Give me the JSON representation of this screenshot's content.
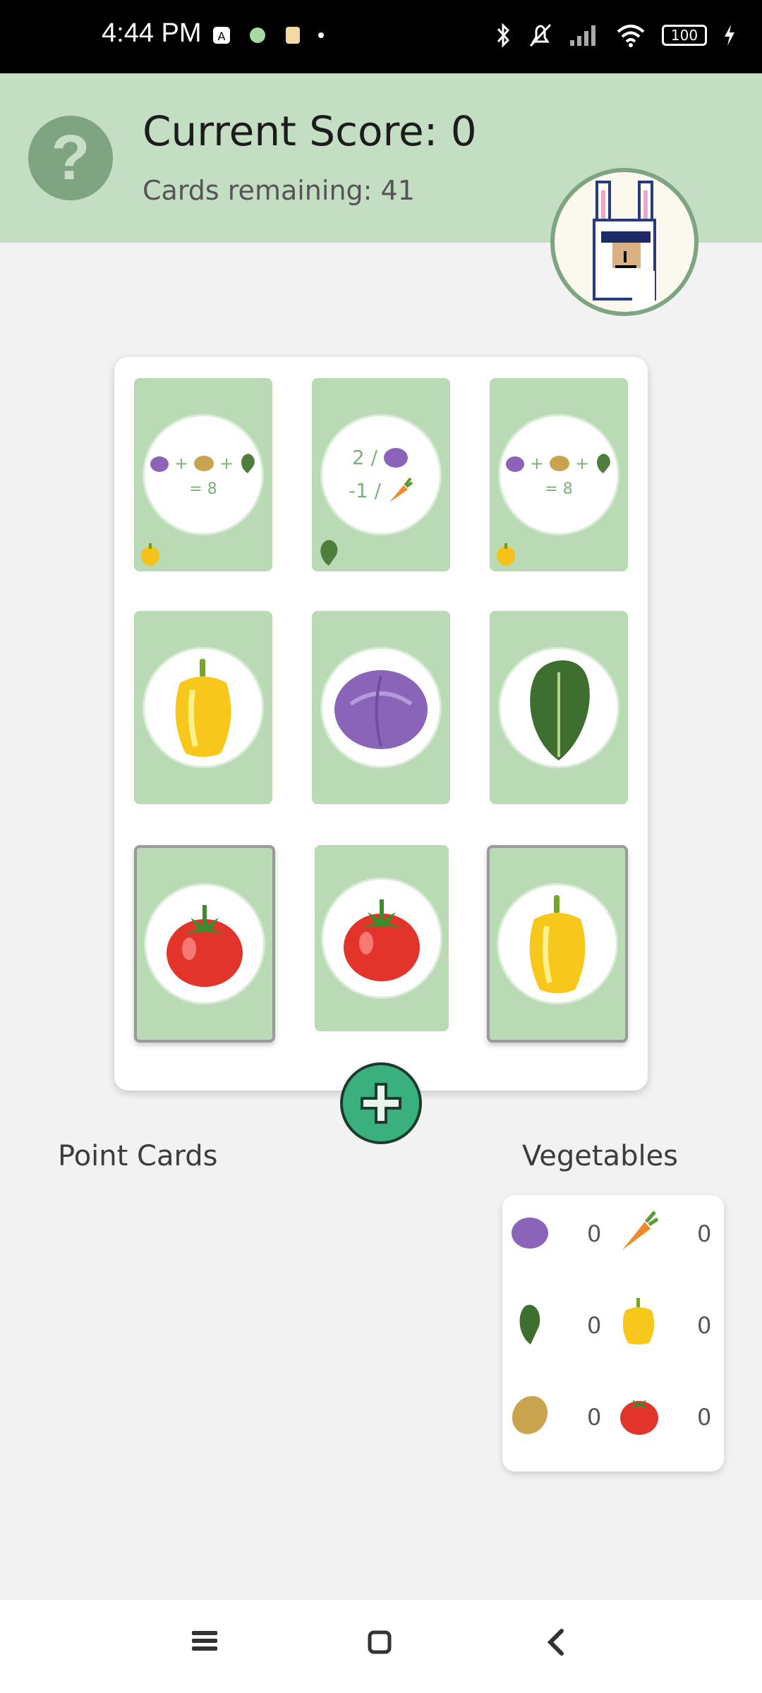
{
  "status_bar": {
    "time": "4:44 PM",
    "battery": "100"
  },
  "header": {
    "score_label": "Current Score: 0",
    "cards_remaining": "Cards remaining: 41"
  },
  "cards": {
    "card1": {
      "formula": "= 8"
    },
    "card2": {
      "line1": "2 /",
      "line2": "-1 /"
    },
    "card3": {
      "formula": "= 8"
    }
  },
  "sections": {
    "point_cards": "Point Cards",
    "vegetables": "Vegetables"
  },
  "vegetable_counts": {
    "cabbage": "0",
    "carrot": "0",
    "lettuce": "0",
    "pepper": "0",
    "potato": "0",
    "tomato": "0"
  }
}
